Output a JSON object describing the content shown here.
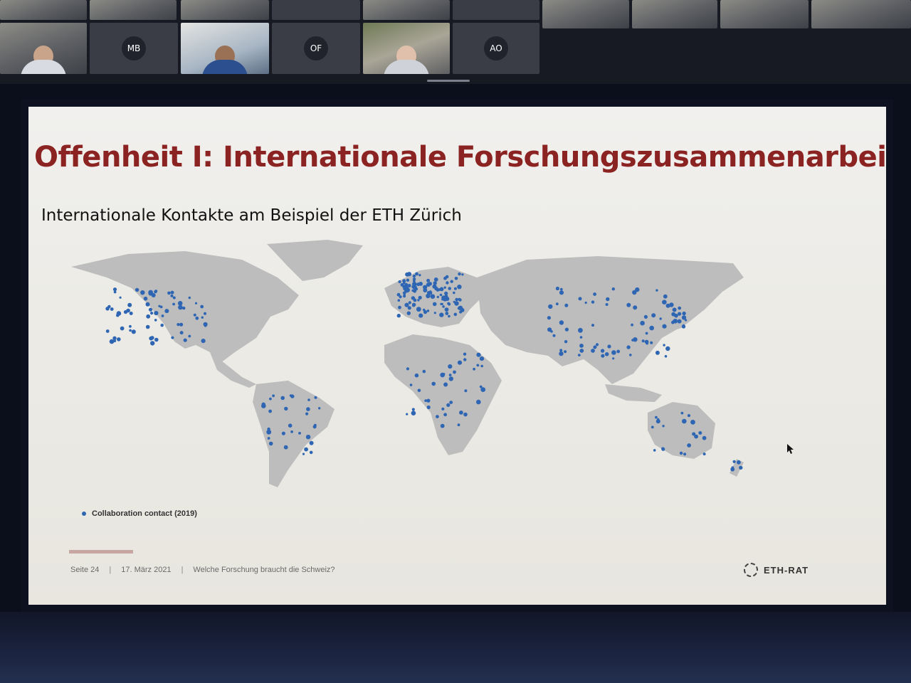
{
  "meeting": {
    "participant_initials": [
      "MB",
      "OF",
      "AO"
    ]
  },
  "slide": {
    "title": "Offenheit I: Internationale Forschungszusammenarbeit",
    "subtitle": "Internationale Kontakte am Beispiel der ETH Zürich",
    "legend_label": "Collaboration contact (2019)",
    "footer": {
      "page": "Seite 24",
      "date": "17. März 2021",
      "topic": "Welche Forschung braucht die Schweiz?",
      "separator": "|"
    },
    "logo_text": "ETH-RAT"
  },
  "colors": {
    "title": "#8c2323",
    "land": "#bdbdbd",
    "contact_dot": "#2f66b3"
  }
}
